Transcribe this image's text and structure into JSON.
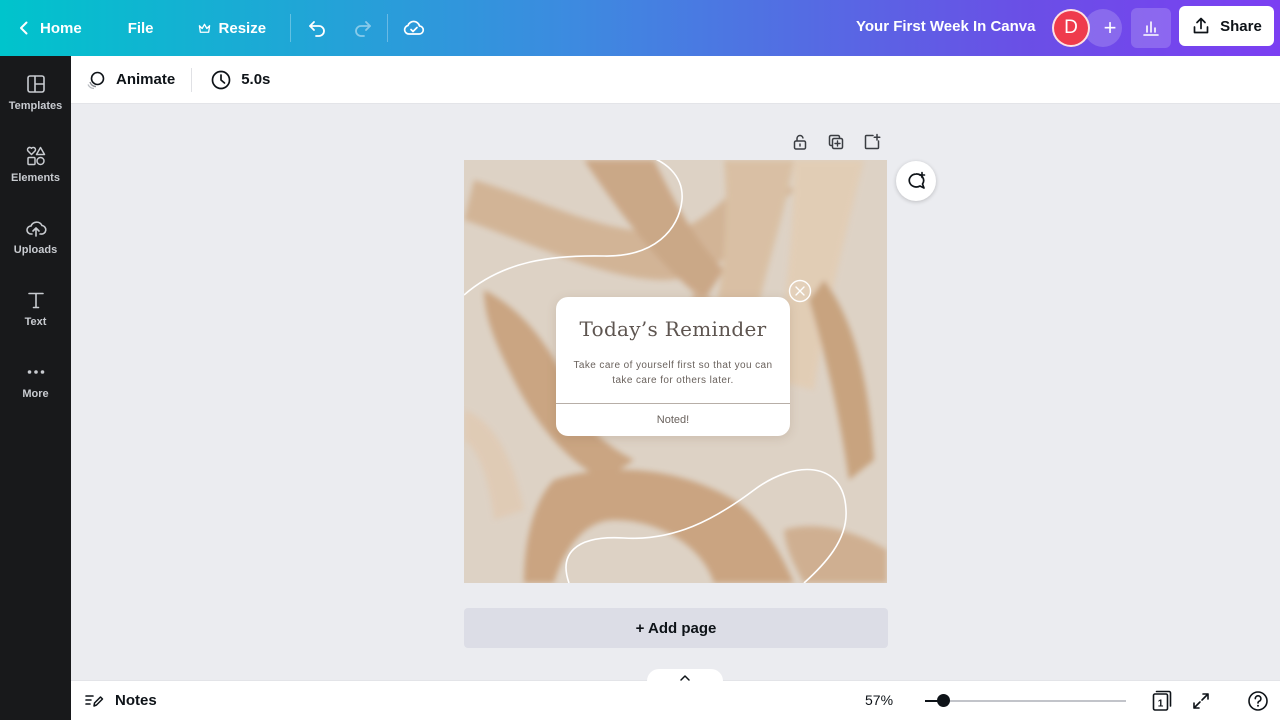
{
  "topbar": {
    "home_label": "Home",
    "file_label": "File",
    "resize_label": "Resize",
    "document_title": "Your First Week In Canva",
    "avatar_initial": "D",
    "add_label": "+",
    "share_label": "Share"
  },
  "sidebar": {
    "items": [
      {
        "label": "Templates",
        "icon": "templates-icon"
      },
      {
        "label": "Elements",
        "icon": "elements-icon"
      },
      {
        "label": "Uploads",
        "icon": "uploads-icon"
      },
      {
        "label": "Text",
        "icon": "text-icon"
      },
      {
        "label": "More",
        "icon": "more-icon"
      }
    ]
  },
  "toolbar": {
    "animate_label": "Animate",
    "duration_label": "5.0s"
  },
  "design": {
    "card_title": "Today’s Reminder",
    "card_text": "Take care of yourself first so that you can take care for others later.",
    "card_action": "Noted!"
  },
  "canvas": {
    "add_page_label": "+ Add page"
  },
  "bottombar": {
    "notes_label": "Notes",
    "zoom_label": "57%",
    "zoom_fraction": 0.09,
    "page_count": "1"
  },
  "colors": {
    "gradient_start": "#00c4cc",
    "gradient_end": "#7b3ff2",
    "sidebar_bg": "#18191b",
    "avatar_bg": "#ef3b4c"
  }
}
